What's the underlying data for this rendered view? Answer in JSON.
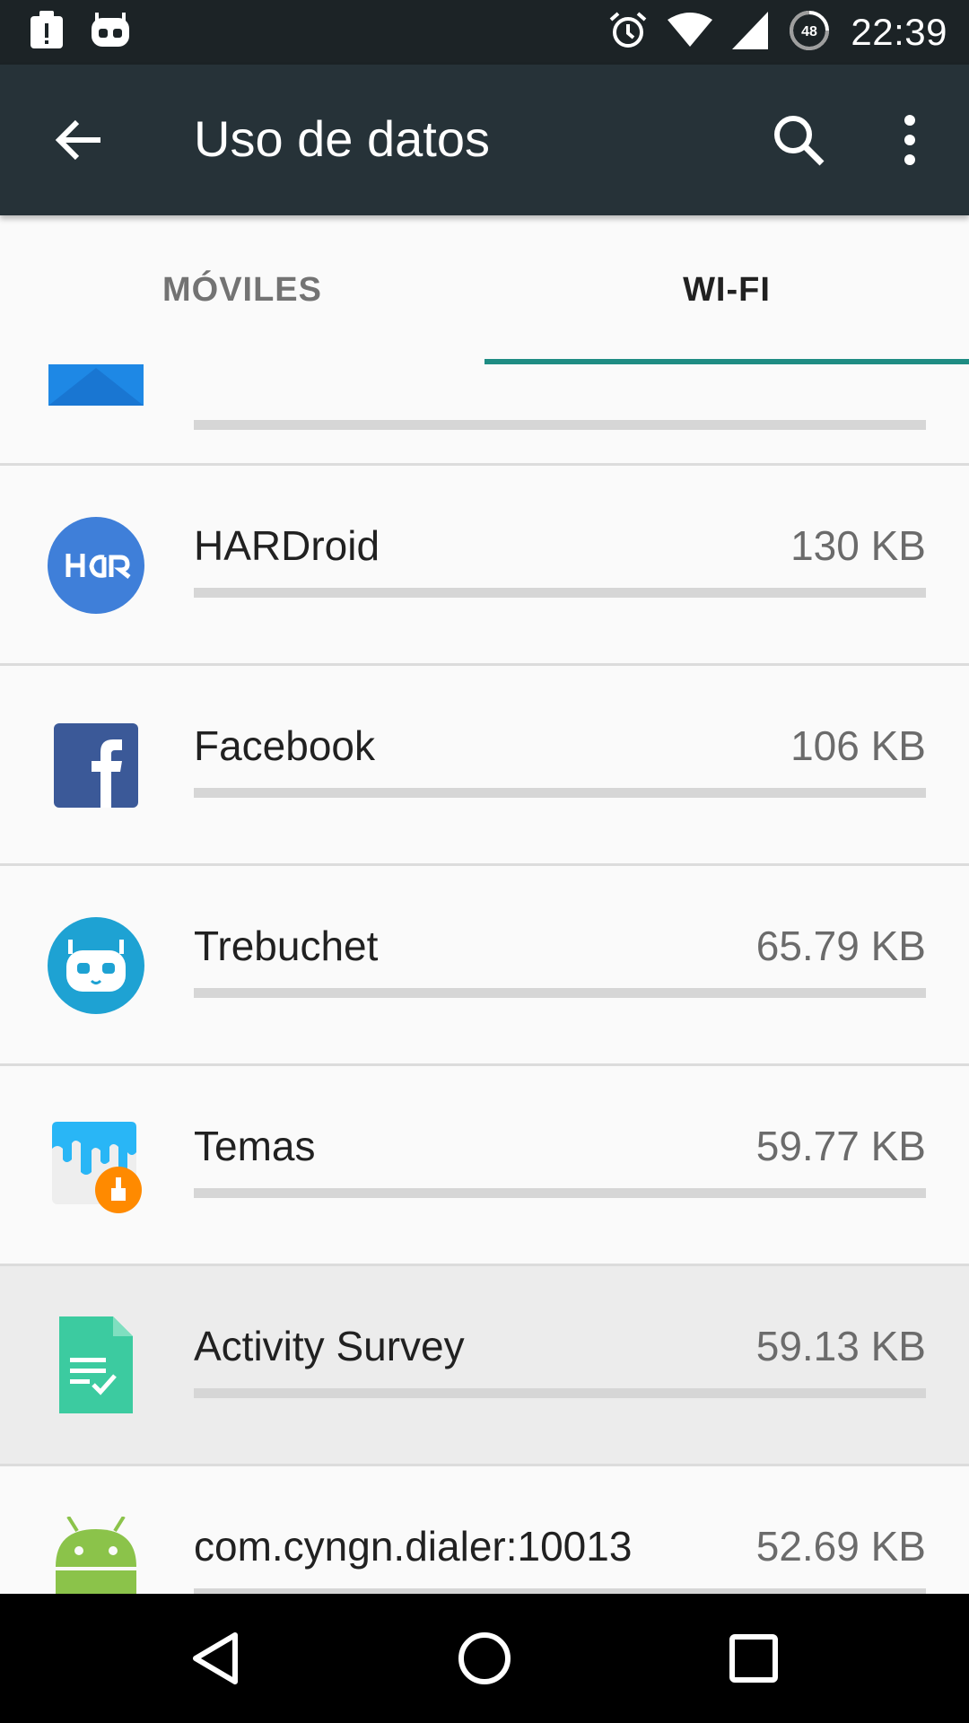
{
  "status_bar": {
    "time": "22:39",
    "battery_level": "48",
    "icons": [
      "notification-alert-icon",
      "cyanogen-icon",
      "alarm-icon",
      "wifi-icon",
      "signal-icon",
      "battery-icon"
    ]
  },
  "toolbar": {
    "title": "Uso de datos",
    "icons": [
      "back-arrow-icon",
      "search-icon",
      "more-vert-icon"
    ]
  },
  "tabs": [
    {
      "label": "MÓVILES",
      "selected": false
    },
    {
      "label": "WI-FI",
      "selected": true
    }
  ],
  "apps": [
    {
      "name": "",
      "size": "",
      "icon": "email-icon",
      "usage_fraction": 0.0
    },
    {
      "name": "HARDroid",
      "size": "130 KB",
      "icon": "hardroid-icon",
      "usage_fraction": 0.0
    },
    {
      "name": "Facebook",
      "size": "106 KB",
      "icon": "facebook-icon",
      "usage_fraction": 0.0
    },
    {
      "name": "Trebuchet",
      "size": "65.79 KB",
      "icon": "trebuchet-icon",
      "usage_fraction": 0.0
    },
    {
      "name": "Temas",
      "size": "59.77 KB",
      "icon": "temas-icon",
      "usage_fraction": 0.0
    },
    {
      "name": "Activity Survey",
      "size": "59.13 KB",
      "icon": "activity-survey-icon",
      "usage_fraction": 0.0
    },
    {
      "name": "com.cyngn.dialer:10013",
      "size": "52.69 KB",
      "icon": "android-icon",
      "usage_fraction": 0.0
    }
  ],
  "nav_bar": {
    "icons": [
      "nav-back-icon",
      "nav-home-icon",
      "nav-recents-icon"
    ]
  },
  "colors": {
    "toolbar": "#263238",
    "status_bar": "#1c2326",
    "accent": "#1e8c83",
    "background": "#fafafa"
  }
}
